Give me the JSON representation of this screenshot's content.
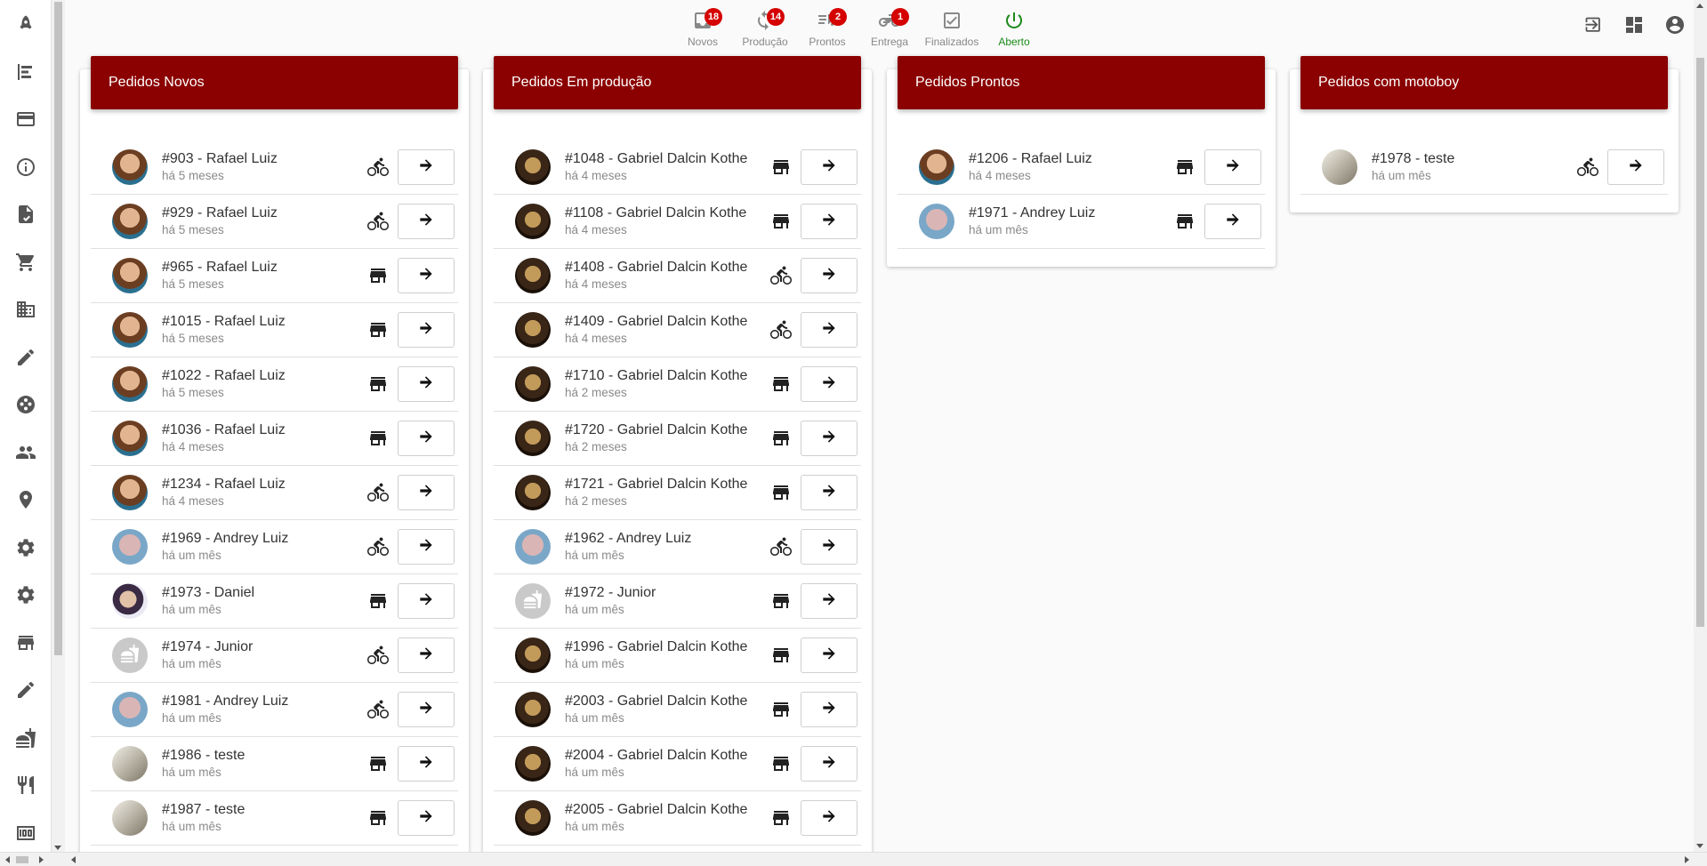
{
  "sidebar": {
    "items": [
      "rocket-icon",
      "align-left-icon",
      "credit-card-icon",
      "info-icon",
      "document-icon",
      "cart-icon",
      "building-icon",
      "pencil-icon",
      "palette-icon",
      "people-icon",
      "location-icon",
      "gear-icon",
      "gear-icon",
      "store-icon",
      "pencil-icon",
      "fastfood-icon",
      "restaurant-icon",
      "money-icon"
    ]
  },
  "topnav": [
    {
      "label": "Novos",
      "badge": "18",
      "icon": "inbox-icon",
      "active": false
    },
    {
      "label": "Produção",
      "badge": "14",
      "icon": "refresh-icon",
      "active": false
    },
    {
      "label": "Prontos",
      "badge": "2",
      "icon": "delivery-icon",
      "active": false
    },
    {
      "label": "Entrega",
      "badge": "1",
      "icon": "motorcycle-icon",
      "active": false
    },
    {
      "label": "Finalizados",
      "badge": "",
      "icon": "checkbox-icon",
      "active": false
    },
    {
      "label": "Aberto",
      "badge": "",
      "icon": "power-icon",
      "active": true
    }
  ],
  "columns": [
    {
      "title": "Pedidos Novos",
      "orders": [
        {
          "title": "#903 - Rafael Luiz",
          "time": "há 5 meses",
          "avatar": "rafael",
          "type": "bike"
        },
        {
          "title": "#929 - Rafael Luiz",
          "time": "há 5 meses",
          "avatar": "rafael",
          "type": "bike"
        },
        {
          "title": "#965 - Rafael Luiz",
          "time": "há 5 meses",
          "avatar": "rafael",
          "type": "store"
        },
        {
          "title": "#1015 - Rafael Luiz",
          "time": "há 5 meses",
          "avatar": "rafael",
          "type": "store"
        },
        {
          "title": "#1022 - Rafael Luiz",
          "time": "há 5 meses",
          "avatar": "rafael",
          "type": "store"
        },
        {
          "title": "#1036 - Rafael Luiz",
          "time": "há 4 meses",
          "avatar": "rafael",
          "type": "store"
        },
        {
          "title": "#1234 - Rafael Luiz",
          "time": "há 4 meses",
          "avatar": "rafael",
          "type": "bike"
        },
        {
          "title": "#1969 - Andrey Luiz",
          "time": "há um mês",
          "avatar": "andrey",
          "type": "bike"
        },
        {
          "title": "#1973 - Daniel",
          "time": "há um mês",
          "avatar": "daniel",
          "type": "store"
        },
        {
          "title": "#1974 - Junior",
          "time": "há um mês",
          "avatar": "junior",
          "type": "bike"
        },
        {
          "title": "#1981 - Andrey Luiz",
          "time": "há um mês",
          "avatar": "andrey",
          "type": "bike"
        },
        {
          "title": "#1986 - teste",
          "time": "há um mês",
          "avatar": "teste",
          "type": "store"
        },
        {
          "title": "#1987 - teste",
          "time": "há um mês",
          "avatar": "teste",
          "type": "store"
        }
      ]
    },
    {
      "title": "Pedidos Em produção",
      "orders": [
        {
          "title": "#1048 - Gabriel Dalcin Kothe",
          "time": "há 4 meses",
          "avatar": "gabriel",
          "type": "store"
        },
        {
          "title": "#1108 - Gabriel Dalcin Kothe",
          "time": "há 4 meses",
          "avatar": "gabriel",
          "type": "store"
        },
        {
          "title": "#1408 - Gabriel Dalcin Kothe",
          "time": "há 4 meses",
          "avatar": "gabriel",
          "type": "bike"
        },
        {
          "title": "#1409 - Gabriel Dalcin Kothe",
          "time": "há 4 meses",
          "avatar": "gabriel",
          "type": "bike"
        },
        {
          "title": "#1710 - Gabriel Dalcin Kothe",
          "time": "há 2 meses",
          "avatar": "gabriel",
          "type": "store"
        },
        {
          "title": "#1720 - Gabriel Dalcin Kothe",
          "time": "há 2 meses",
          "avatar": "gabriel",
          "type": "store"
        },
        {
          "title": "#1721 - Gabriel Dalcin Kothe",
          "time": "há 2 meses",
          "avatar": "gabriel",
          "type": "store"
        },
        {
          "title": "#1962 - Andrey Luiz",
          "time": "há um mês",
          "avatar": "andrey",
          "type": "bike"
        },
        {
          "title": "#1972 - Junior",
          "time": "há um mês",
          "avatar": "junior",
          "type": "store"
        },
        {
          "title": "#1996 - Gabriel Dalcin Kothe",
          "time": "há um mês",
          "avatar": "gabriel",
          "type": "store"
        },
        {
          "title": "#2003 - Gabriel Dalcin Kothe",
          "time": "há um mês",
          "avatar": "gabriel",
          "type": "store"
        },
        {
          "title": "#2004 - Gabriel Dalcin Kothe",
          "time": "há um mês",
          "avatar": "gabriel",
          "type": "store"
        },
        {
          "title": "#2005 - Gabriel Dalcin Kothe",
          "time": "há um mês",
          "avatar": "gabriel",
          "type": "store"
        }
      ]
    },
    {
      "title": "Pedidos Prontos",
      "orders": [
        {
          "title": "#1206 - Rafael Luiz",
          "time": "há 4 meses",
          "avatar": "rafael",
          "type": "store"
        },
        {
          "title": "#1971 - Andrey Luiz",
          "time": "há um mês",
          "avatar": "andrey",
          "type": "store"
        }
      ]
    },
    {
      "title": "Pedidos com motoboy",
      "orders": [
        {
          "title": "#1978 - teste",
          "time": "há um mês",
          "avatar": "teste",
          "type": "bike"
        }
      ]
    }
  ],
  "colors": {
    "header": "#8b0000",
    "active": "#1b8a1b",
    "badge": "#d50000"
  }
}
